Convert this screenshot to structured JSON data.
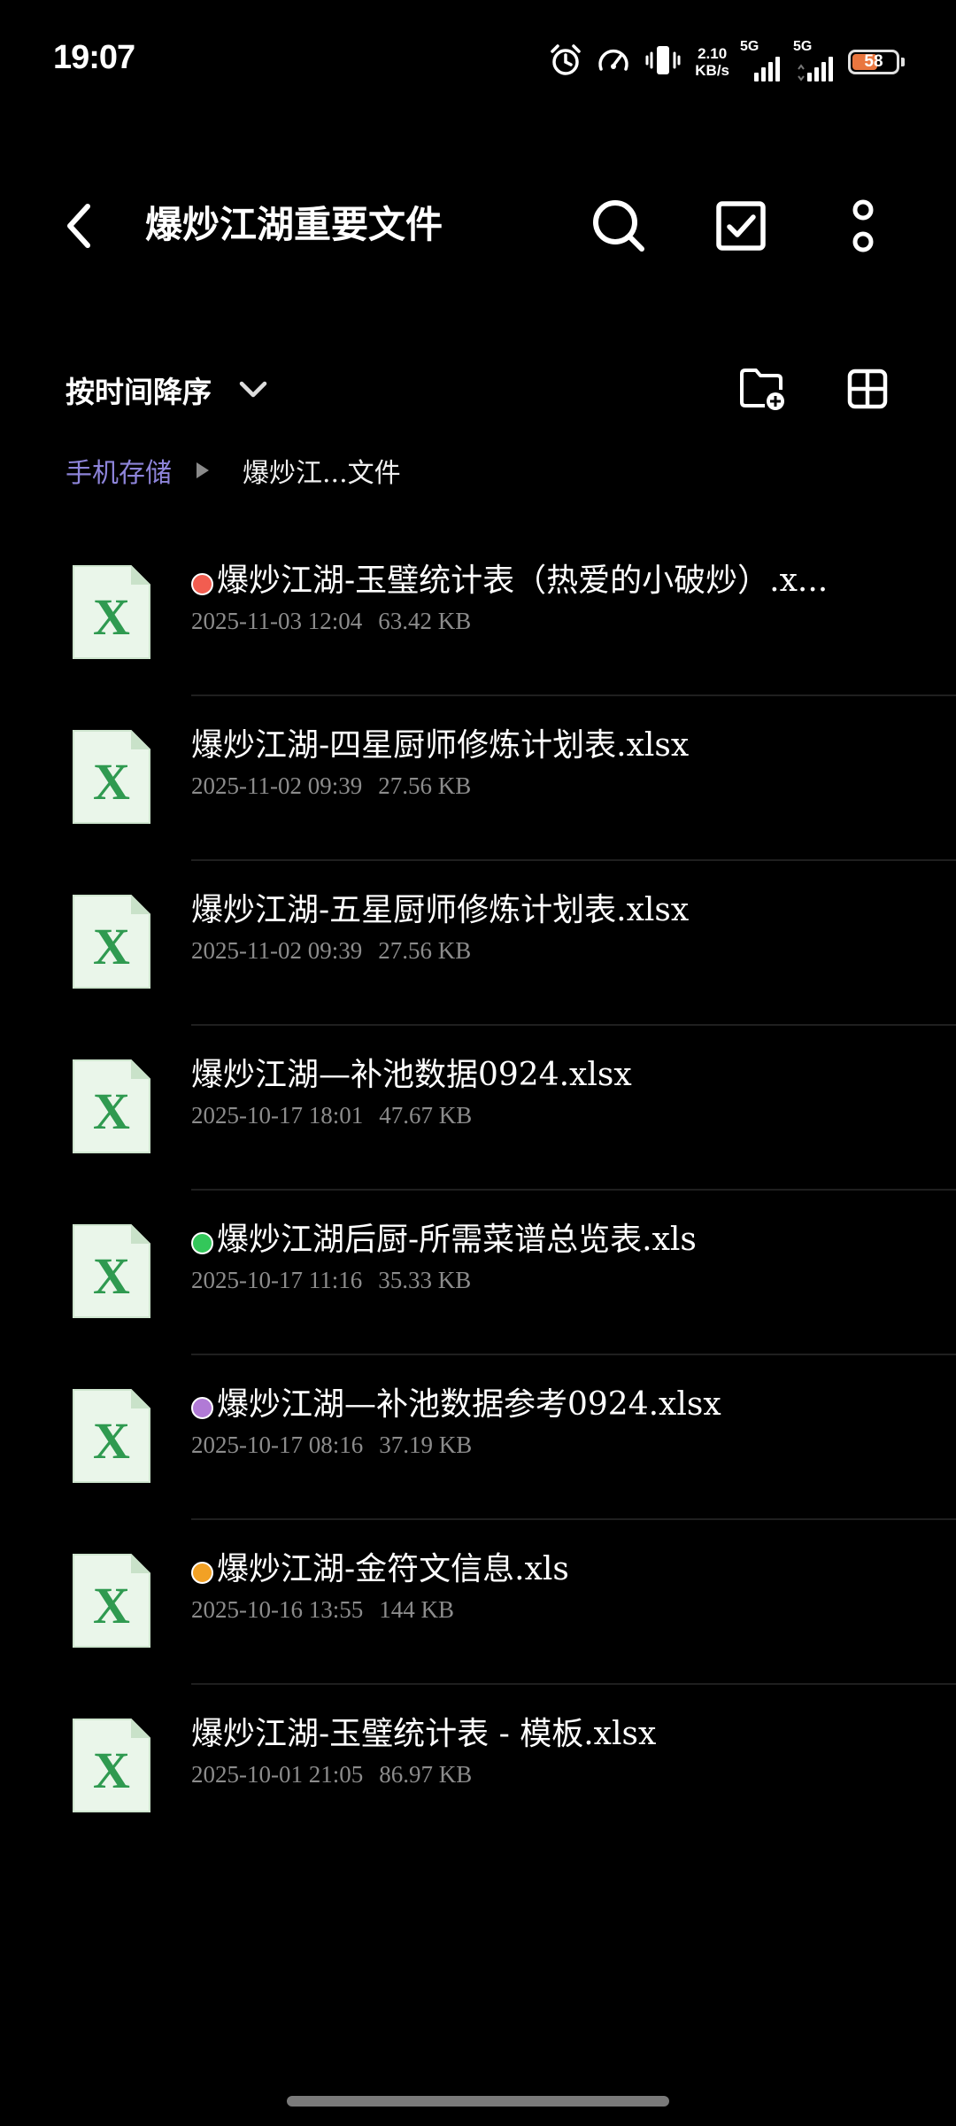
{
  "status_bar": {
    "time": "19:07",
    "net_speed_value": "2.10",
    "net_speed_unit": "KB/s",
    "signal1_label": "5G",
    "signal2_label": "5G",
    "battery": "58",
    "battery_level": 0.58
  },
  "header": {
    "title": "爆炒江湖重要文件"
  },
  "toolbar": {
    "sort_label": "按时间降序"
  },
  "breadcrumb": {
    "root": "手机存储",
    "current": "爆炒江...文件"
  },
  "colors": {
    "tag_red": "#f25d50",
    "tag_green": "#33c75a",
    "tag_purple": "#b17ad6",
    "tag_orange": "#f2a125",
    "excel_green": "#2f9a50",
    "breadcrumb_root": "#8d84d9"
  },
  "files": [
    {
      "name": "爆炒江湖-玉璧统计表（热爱的小破炒）.x...",
      "date": "2025-11-03 12:04",
      "size": "63.42 KB",
      "tag": "red"
    },
    {
      "name": "爆炒江湖-四星厨师修炼计划表.xlsx",
      "date": "2025-11-02 09:39",
      "size": "27.56 KB",
      "tag": ""
    },
    {
      "name": "爆炒江湖-五星厨师修炼计划表.xlsx",
      "date": "2025-11-02 09:39",
      "size": "27.56 KB",
      "tag": ""
    },
    {
      "name": "爆炒江湖—补池数据0924.xlsx",
      "date": "2025-10-17 18:01",
      "size": "47.67 KB",
      "tag": ""
    },
    {
      "name": "爆炒江湖后厨-所需菜谱总览表.xls",
      "date": "2025-10-17 11:16",
      "size": "35.33 KB",
      "tag": "green"
    },
    {
      "name": "爆炒江湖—补池数据参考0924.xlsx",
      "date": "2025-10-17 08:16",
      "size": "37.19 KB",
      "tag": "purple"
    },
    {
      "name": "爆炒江湖-金符文信息.xls",
      "date": "2025-10-16 13:55",
      "size": "144 KB",
      "tag": "orange"
    },
    {
      "name": "爆炒江湖-玉璧统计表 - 模板.xlsx",
      "date": "2025-10-01 21:05",
      "size": "86.97 KB",
      "tag": ""
    }
  ]
}
